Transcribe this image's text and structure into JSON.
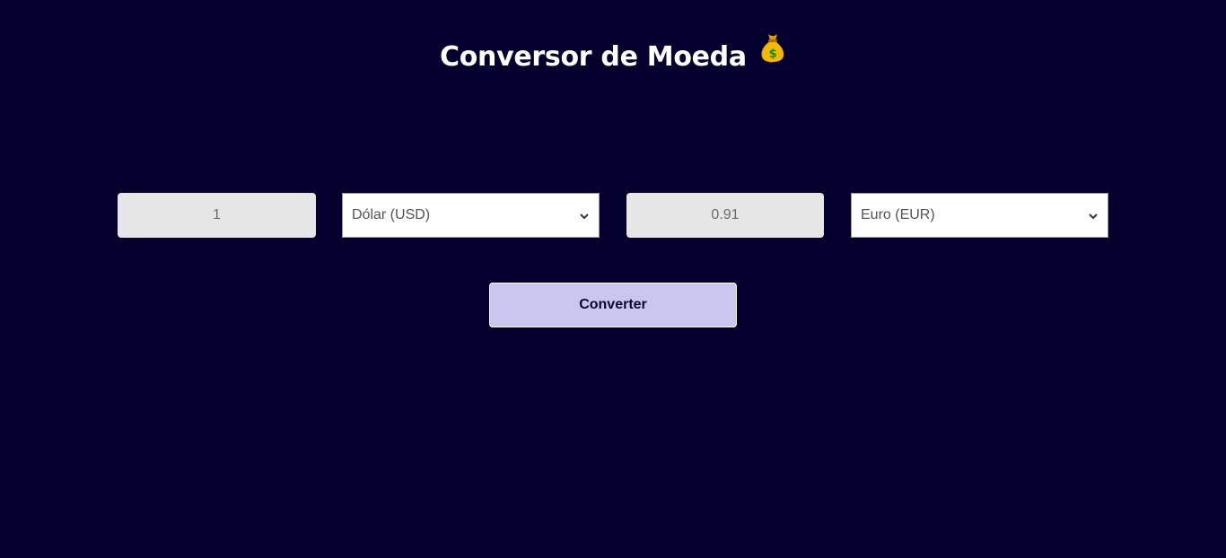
{
  "header": {
    "title": "Conversor de Moeda"
  },
  "converter": {
    "from_amount": "1",
    "from_currency": "Dólar (USD)",
    "to_amount": "0.91",
    "to_currency": "Euro (EUR)",
    "convert_label": "Converter"
  },
  "colors": {
    "background": "#04002e",
    "button": "#cac6ee",
    "input": "#e6e6e6"
  },
  "icons": {
    "title_emoji": "money-bag-icon",
    "select_arrow": "chevron-down-icon"
  }
}
